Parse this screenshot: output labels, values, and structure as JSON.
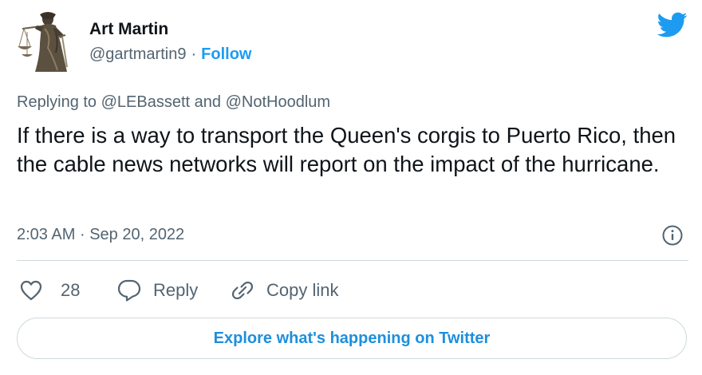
{
  "author": {
    "name": "Art Martin",
    "handle": "@gartmartin9",
    "separator": "·",
    "follow_label": "Follow",
    "avatar_icon": "lady-justice-statue-avatar"
  },
  "brand": {
    "icon": "twitter-bird-icon",
    "color": "#1d9bf0"
  },
  "reply": {
    "prefix": "Replying to",
    "mention_1": "@LEBassett",
    "conjunction": "and",
    "mention_2": "@NotHoodlum"
  },
  "tweet": {
    "text": "If there is a way to transport the Queen's corgis to Puerto Rico, then the cable news networks will report on the impact of the hurricane.",
    "time": "2:03 AM",
    "separator": "·",
    "date": "Sep 20, 2022"
  },
  "actions": {
    "like_count": "28",
    "reply_label": "Reply",
    "copy_link_label": "Copy link"
  },
  "explore_label": "Explore what's happening on Twitter",
  "colors": {
    "text_primary": "#0f1419",
    "text_secondary": "#536471",
    "link": "#1d9bf0",
    "border": "#cfd9de"
  }
}
